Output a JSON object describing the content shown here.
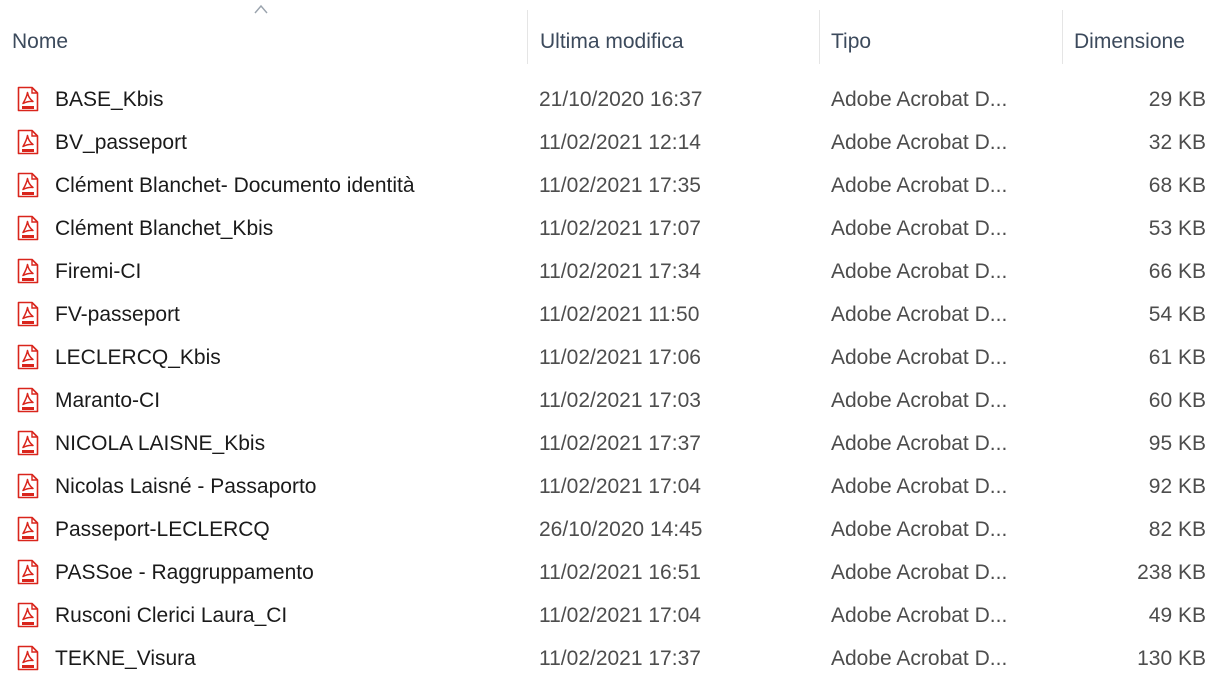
{
  "columns": {
    "name": "Nome",
    "modified": "Ultima modifica",
    "type": "Tipo",
    "size": "Dimensione"
  },
  "sort": {
    "column": "name",
    "direction": "ascending"
  },
  "colors": {
    "pdf_icon": "#d9251c",
    "header_text": "#3c4a5c"
  },
  "files": [
    {
      "icon": "pdf-icon",
      "name": "BASE_Kbis",
      "modified": "21/10/2020 16:37",
      "type": "Adobe Acrobat D...",
      "size": "29 KB"
    },
    {
      "icon": "pdf-icon",
      "name": "BV_passeport",
      "modified": "11/02/2021 12:14",
      "type": "Adobe Acrobat D...",
      "size": "32 KB"
    },
    {
      "icon": "pdf-icon",
      "name": "Clément Blanchet- Documento identità",
      "modified": "11/02/2021 17:35",
      "type": "Adobe Acrobat D...",
      "size": "68 KB"
    },
    {
      "icon": "pdf-icon",
      "name": "Clément Blanchet_Kbis",
      "modified": "11/02/2021 17:07",
      "type": "Adobe Acrobat D...",
      "size": "53 KB"
    },
    {
      "icon": "pdf-icon",
      "name": "Firemi-CI",
      "modified": "11/02/2021 17:34",
      "type": "Adobe Acrobat D...",
      "size": "66 KB"
    },
    {
      "icon": "pdf-icon",
      "name": "FV-passeport",
      "modified": "11/02/2021 11:50",
      "type": "Adobe Acrobat D...",
      "size": "54 KB"
    },
    {
      "icon": "pdf-icon",
      "name": "LECLERCQ_Kbis",
      "modified": "11/02/2021 17:06",
      "type": "Adobe Acrobat D...",
      "size": "61 KB"
    },
    {
      "icon": "pdf-icon",
      "name": "Maranto-CI",
      "modified": "11/02/2021 17:03",
      "type": "Adobe Acrobat D...",
      "size": "60 KB"
    },
    {
      "icon": "pdf-icon",
      "name": "NICOLA LAISNE_Kbis",
      "modified": "11/02/2021 17:37",
      "type": "Adobe Acrobat D...",
      "size": "95 KB"
    },
    {
      "icon": "pdf-icon",
      "name": "Nicolas Laisné - Passaporto",
      "modified": "11/02/2021 17:04",
      "type": "Adobe Acrobat D...",
      "size": "92 KB"
    },
    {
      "icon": "pdf-icon",
      "name": "Passeport-LECLERCQ",
      "modified": "26/10/2020 14:45",
      "type": "Adobe Acrobat D...",
      "size": "82 KB"
    },
    {
      "icon": "pdf-icon",
      "name": "PASSoe - Raggruppamento",
      "modified": "11/02/2021 16:51",
      "type": "Adobe Acrobat D...",
      "size": "238 KB"
    },
    {
      "icon": "pdf-icon",
      "name": "Rusconi Clerici Laura_CI",
      "modified": "11/02/2021 17:04",
      "type": "Adobe Acrobat D...",
      "size": "49 KB"
    },
    {
      "icon": "pdf-icon",
      "name": "TEKNE_Visura",
      "modified": "11/02/2021 17:37",
      "type": "Adobe Acrobat D...",
      "size": "130 KB"
    }
  ]
}
